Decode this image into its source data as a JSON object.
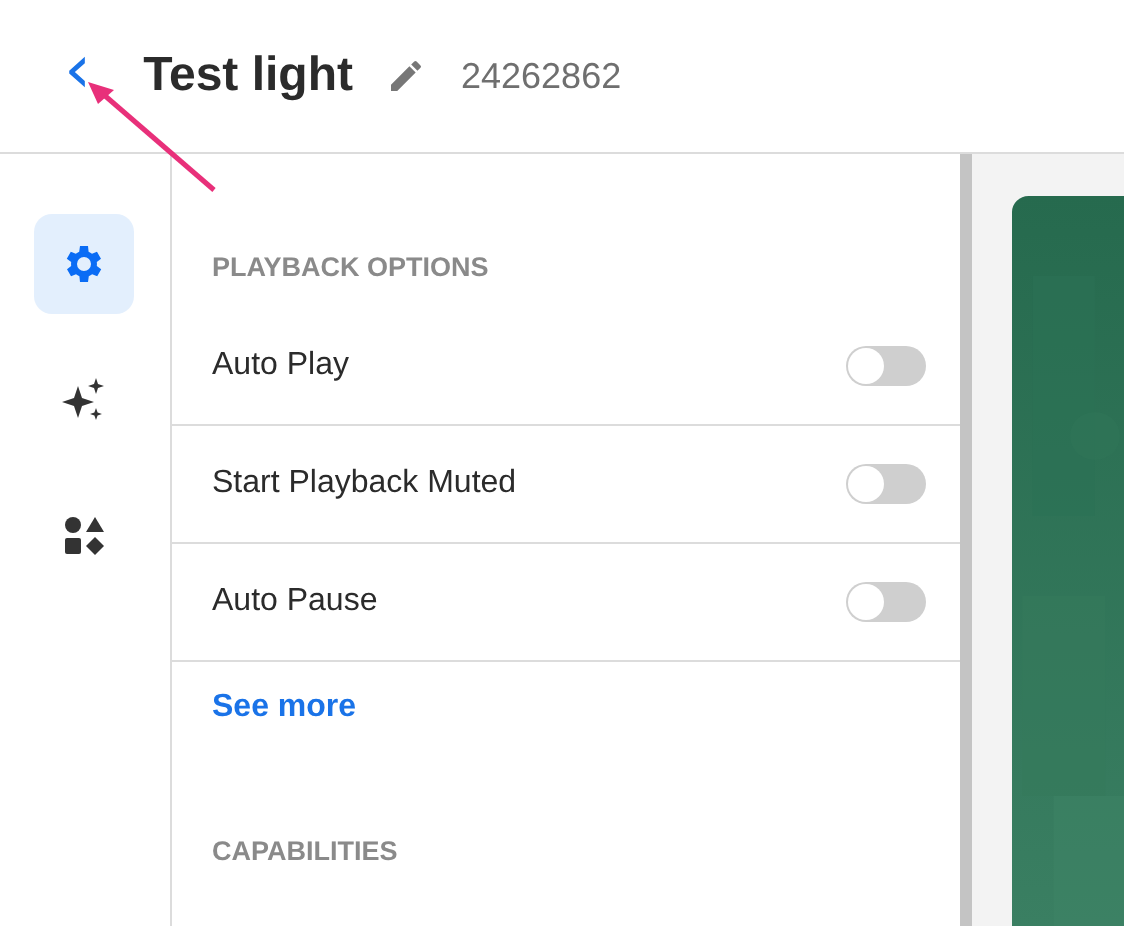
{
  "header": {
    "back_icon": "‹",
    "title": "Test light",
    "id": "24262862"
  },
  "sidebar": {
    "items": [
      {
        "kind": "gear",
        "selected": true
      },
      {
        "kind": "sparkles",
        "selected": false
      },
      {
        "kind": "shapes",
        "selected": false
      }
    ]
  },
  "panel": {
    "section_title": "PLAYBACK OPTIONS",
    "settings": [
      {
        "label": "Auto Play",
        "on": false
      },
      {
        "label": "Start Playback Muted",
        "on": false
      },
      {
        "label": "Auto Pause",
        "on": false
      }
    ],
    "see_more": "See more",
    "next_section_title": "CAPABILITIES"
  }
}
